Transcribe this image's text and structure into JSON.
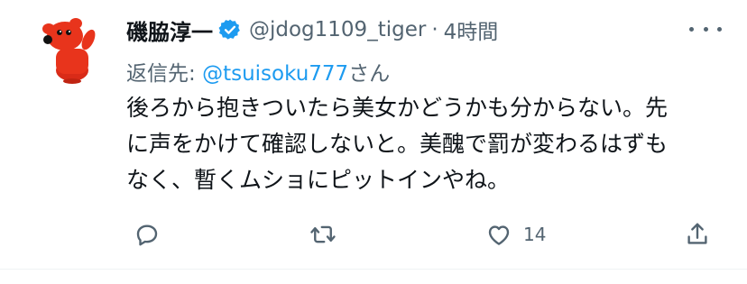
{
  "user": {
    "display_name": "磯脇淳一",
    "handle": "@jdog1109_tiger",
    "separator": "·",
    "time": "4時間",
    "verified": true
  },
  "reply": {
    "prefix": "返信先:",
    "mention": "@tsuisoku777",
    "suffix": "さん"
  },
  "body_lines": [
    "後ろから抱きついたら美女かどうかも分からない。先",
    "に声をかけて確認しないと。美醜で罰が変わるはずも",
    "なく、暫くムショにピットインやね。"
  ],
  "actions": {
    "like_count": "14"
  },
  "colors": {
    "text": "#0f1419",
    "secondary": "#536471",
    "accent": "#1d9bf0",
    "avatar_red": "#e8341c"
  },
  "icons": [
    "verified-badge-icon",
    "more-icon",
    "reply-icon",
    "retweet-icon",
    "like-icon",
    "share-icon"
  ]
}
